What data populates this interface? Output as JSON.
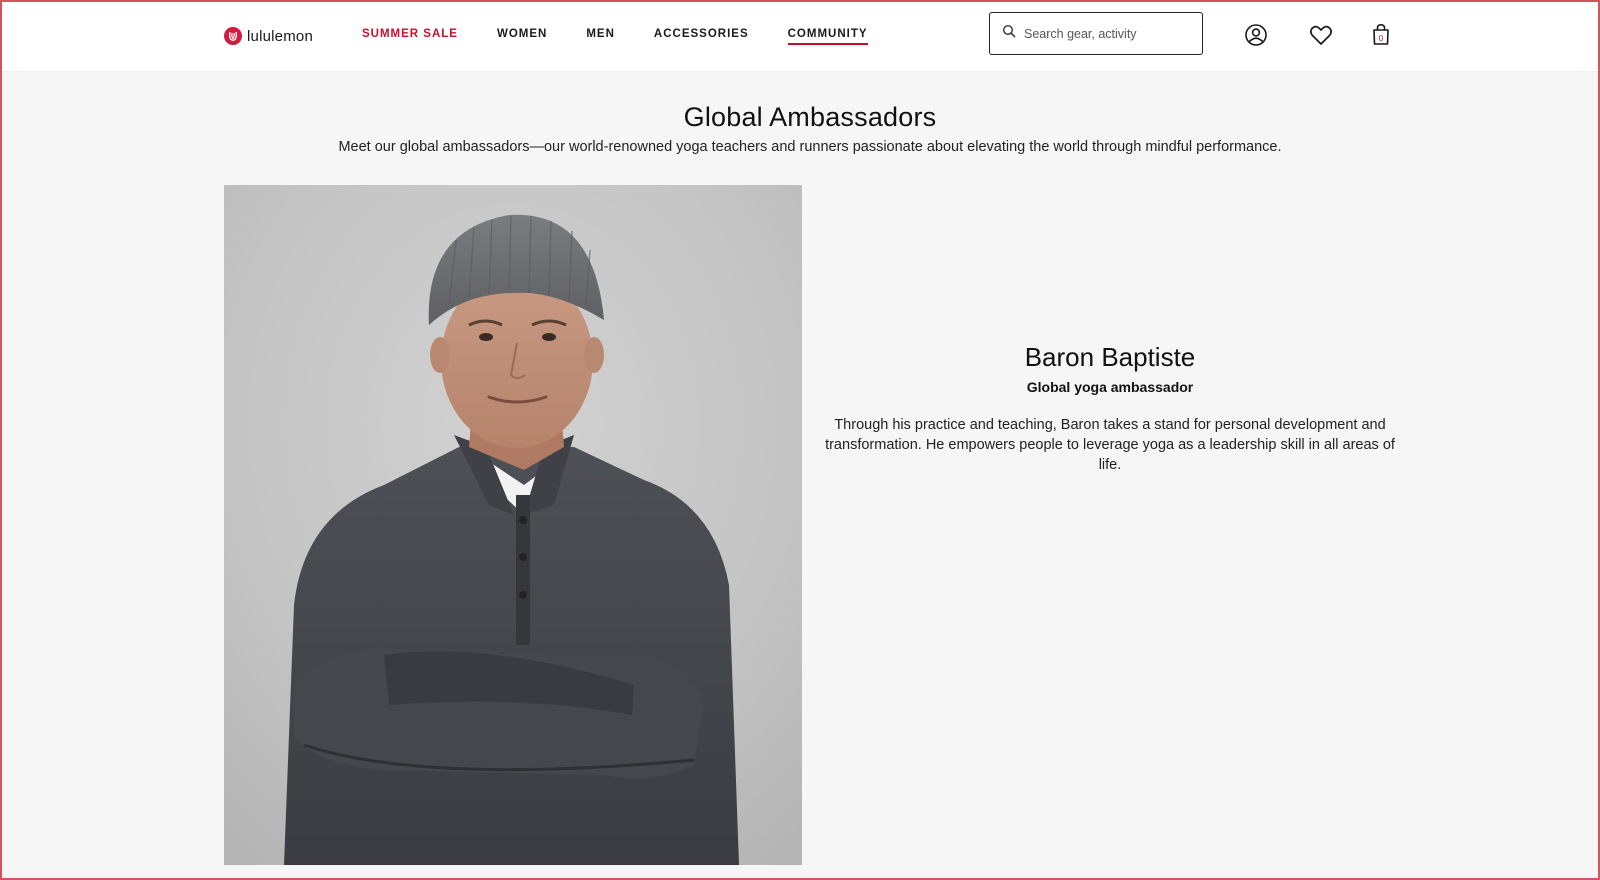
{
  "brand": {
    "name": "lululemon",
    "logo_color": "#d31a3f"
  },
  "nav": {
    "items": [
      {
        "label": "SUMMER SALE",
        "variant": "sale"
      },
      {
        "label": "WOMEN",
        "variant": "default"
      },
      {
        "label": "MEN",
        "variant": "default"
      },
      {
        "label": "ACCESSORIES",
        "variant": "default"
      },
      {
        "label": "COMMUNITY",
        "variant": "active"
      }
    ],
    "accent_color": "#c8102e"
  },
  "search": {
    "placeholder": "Search gear, activity",
    "icon": "search-icon"
  },
  "header_icons": {
    "account": "account-icon",
    "wishlist": "heart-icon",
    "bag": "shopping-bag-icon",
    "bag_count": "0"
  },
  "main": {
    "title": "Global Ambassadors",
    "subtitle": "Meet our global ambassadors—our world-renowned yoga teachers and runners passionate about elevating the world through mindful performance."
  },
  "ambassador": {
    "name": "Baron Baptiste",
    "role": "Global yoga ambassador",
    "bio": "Through his practice and teaching, Baron takes a stand for personal development and transformation. He empowers people to leverage yoga as a leadership skill in all areas of life."
  }
}
